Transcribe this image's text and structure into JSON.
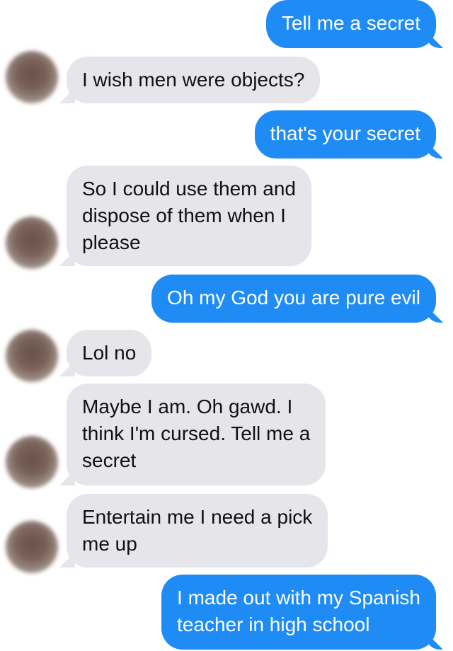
{
  "colors": {
    "outgoing_bubble": "#1f8bf5",
    "incoming_bubble": "#e5e5ea"
  },
  "messages": [
    {
      "direction": "outgoing",
      "text": "Tell me a secret"
    },
    {
      "direction": "incoming",
      "text": "I wish men were objects?"
    },
    {
      "direction": "outgoing",
      "text": "that's your secret"
    },
    {
      "direction": "incoming",
      "text": "So I could use them and\ndispose of them when I\nplease"
    },
    {
      "direction": "outgoing",
      "text": "Oh my God you are pure evil"
    },
    {
      "direction": "incoming",
      "text": "Lol no"
    },
    {
      "direction": "incoming",
      "text": "Maybe I am. Oh gawd. I\nthink I'm cursed. Tell me a\nsecret"
    },
    {
      "direction": "incoming",
      "text": "Entertain me I need a pick\nme up"
    },
    {
      "direction": "outgoing",
      "text": "I made out with my Spanish\nteacher in high school"
    }
  ]
}
